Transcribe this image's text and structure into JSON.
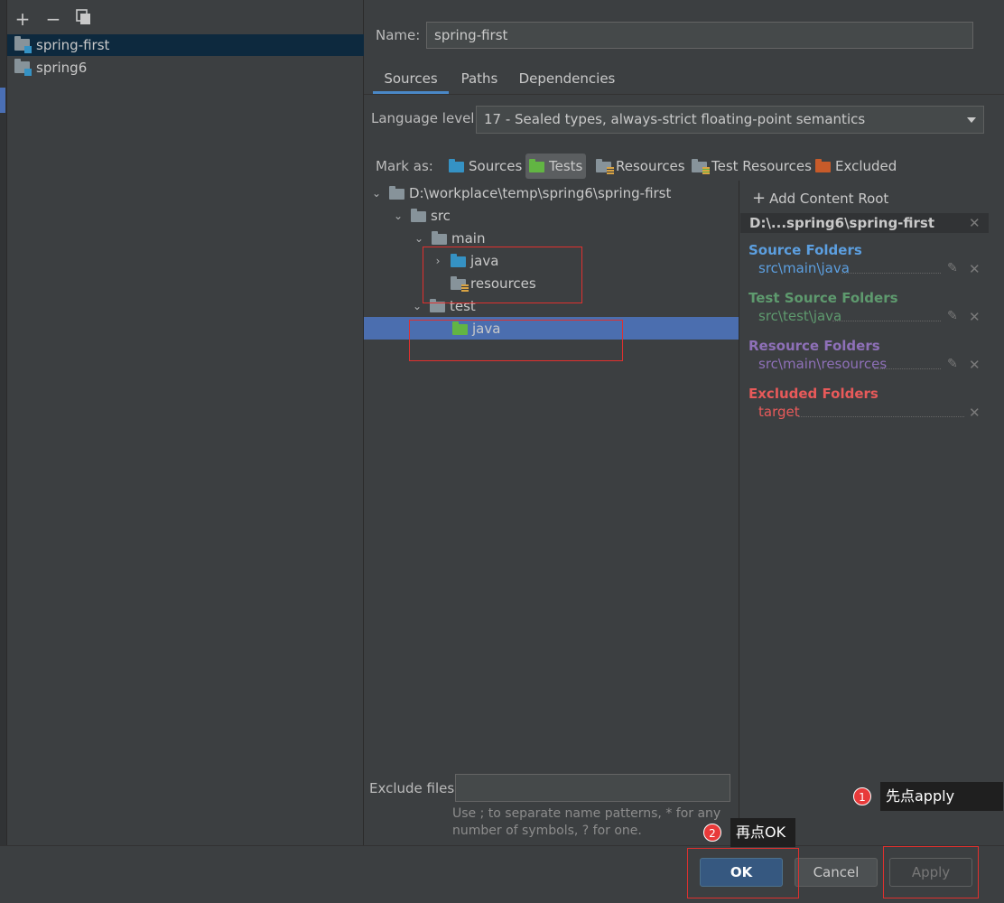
{
  "toolbar": {
    "add_icon": "plus-icon",
    "remove_icon": "minus-icon",
    "copy_icon": "copy-icon"
  },
  "modules": [
    {
      "name": "spring-first",
      "selected": true
    },
    {
      "name": "spring6",
      "selected": false
    }
  ],
  "name_label": "Name:",
  "name_value": "spring-first",
  "tabs": [
    "Sources",
    "Paths",
    "Dependencies"
  ],
  "language_level_label": "Language level:",
  "language_level_value": "17 - Sealed types, always-strict floating-point semantics",
  "mark_as_label": "Mark as:",
  "mark_as": [
    "Sources",
    "Tests",
    "Resources",
    "Test Resources",
    "Excluded"
  ],
  "tree": {
    "root": "D:\\workplace\\temp\\spring6\\spring-first",
    "src": "src",
    "main": "main",
    "main_java": "java",
    "resources": "resources",
    "test": "test",
    "test_java": "java"
  },
  "content_root": {
    "add_label": "Add Content Root",
    "header": "D:\\...spring6\\spring-first",
    "source_title": "Source Folders",
    "source_path": "src\\main\\java",
    "test_title": "Test Source Folders",
    "test_path": "src\\test\\java",
    "resource_title": "Resource Folders",
    "resource_path": "src\\main\\resources",
    "excluded_title": "Excluded Folders",
    "excluded_path": "target"
  },
  "exclude_files_label": "Exclude files:",
  "exclude_files_value": "",
  "exclude_hint_line1": "Use ; to separate name patterns, * for any",
  "exclude_hint_line2": "number of symbols, ? for one.",
  "buttons": {
    "ok": "OK",
    "cancel": "Cancel",
    "apply": "Apply"
  },
  "annotations": {
    "step1_num": "1",
    "step1_text": "先点apply",
    "step2_num": "2",
    "step2_text": "再点OK"
  },
  "colors": {
    "source": "#5c9fe0",
    "test": "#5e9a6e",
    "resource": "#8e70b8",
    "excluded": "#e85a5a",
    "highlight": "#e0302e"
  }
}
